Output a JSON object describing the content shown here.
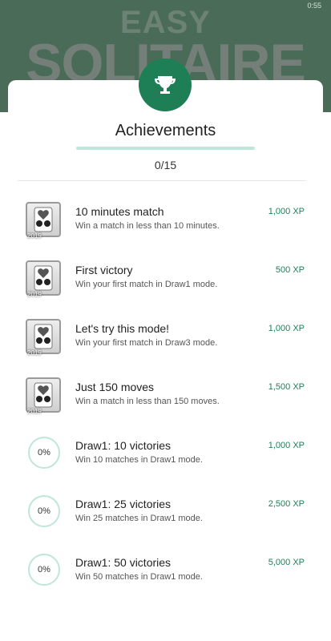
{
  "status": {
    "time": "0:55"
  },
  "background": {
    "logo_line1": "EASY",
    "logo_line2": "SOLITAIRE"
  },
  "sheet": {
    "title": "Achievements",
    "progress_text": "0/15",
    "badge_icon": "trophy-icon"
  },
  "achievements": [
    {
      "icon": "solitaire-thumb",
      "year": "2019",
      "title": "10 minutes match",
      "desc": "Win a match in less than 10 minutes.",
      "xp": "1,000 XP"
    },
    {
      "icon": "solitaire-thumb",
      "year": "2019",
      "title": "First victory",
      "desc": "Win your first match in Draw1 mode.",
      "xp": "500 XP"
    },
    {
      "icon": "solitaire-thumb",
      "year": "2019",
      "title": "Let's try this mode!",
      "desc": "Win your first match in Draw3 mode.",
      "xp": "1,000 XP"
    },
    {
      "icon": "solitaire-thumb",
      "year": "2019",
      "title": "Just 150 moves",
      "desc": "Win a match in less than 150 moves.",
      "xp": "1,500 XP"
    },
    {
      "icon": "progress-circle",
      "percent": "0%",
      "title": "Draw1: 10 victories",
      "desc": "Win 10 matches in Draw1 mode.",
      "xp": "1,000 XP"
    },
    {
      "icon": "progress-circle",
      "percent": "0%",
      "title": "Draw1: 25 victories",
      "desc": "Win 25 matches in Draw1 mode.",
      "xp": "2,500 XP"
    },
    {
      "icon": "progress-circle",
      "percent": "0%",
      "title": "Draw1: 50 victories",
      "desc": "Win 50 matches in Draw1 mode.",
      "xp": "5,000 XP"
    }
  ],
  "colors": {
    "accent": "#1e7f57",
    "progress_track": "#bfe6db",
    "header_bg": "#4a6b58"
  }
}
